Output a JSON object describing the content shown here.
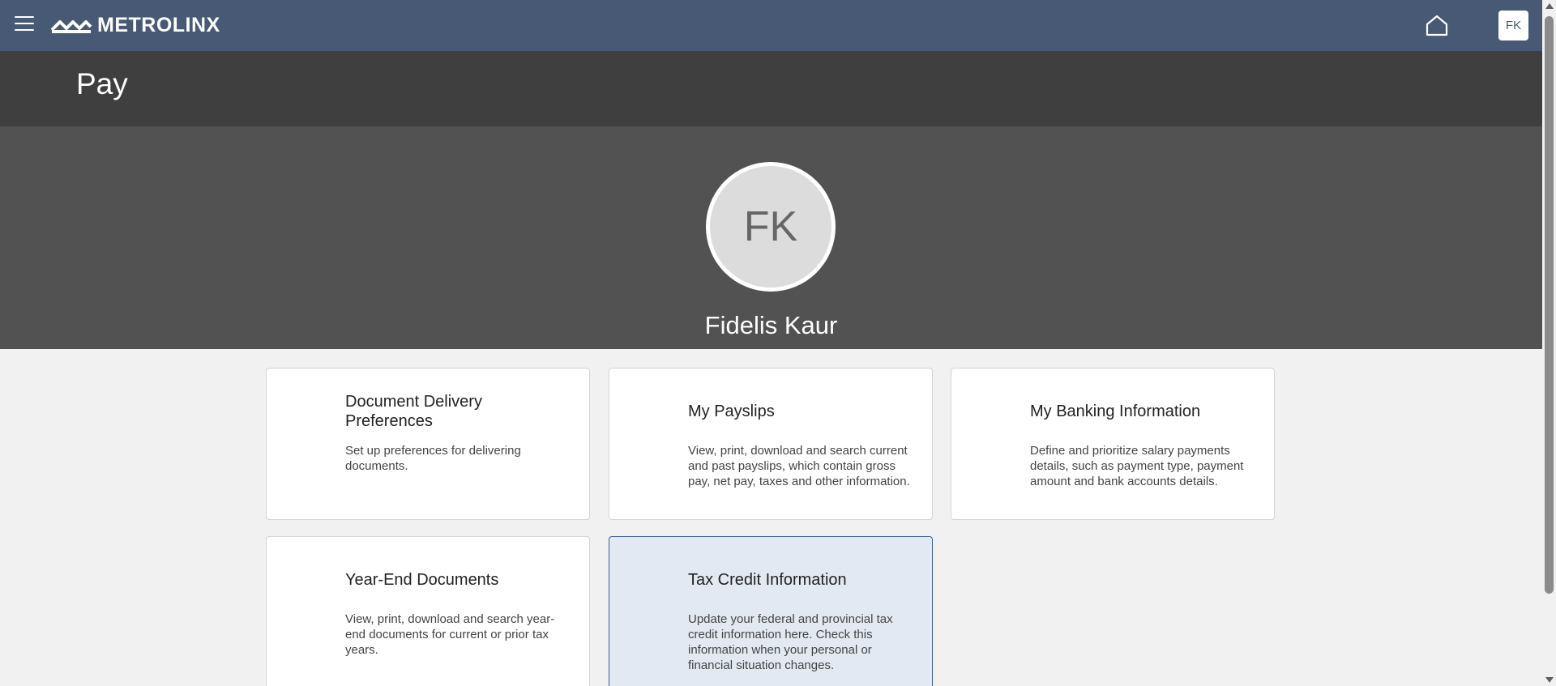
{
  "header": {
    "brand": "METROLINX",
    "user_initials": "FK",
    "icons": {
      "menu": "hamburger-menu-icon",
      "home": "home-icon"
    },
    "colors": {
      "bar": "#475975"
    }
  },
  "page": {
    "title": "Pay"
  },
  "profile": {
    "initials": "FK",
    "name": "Fidelis Kaur"
  },
  "cards": [
    {
      "title": "Document Delivery Preferences",
      "description": "Set up preferences for delivering documents."
    },
    {
      "title": "My Payslips",
      "description": "View, print, download and search current and past payslips, which contain gross pay, net pay, taxes and other information."
    },
    {
      "title": "My Banking Information",
      "description": "Define and prioritize salary payments details, such as payment type, payment amount and bank accounts details."
    },
    {
      "title": "Year-End Documents",
      "description": "View, print, download and search year-end documents for current or prior tax years."
    },
    {
      "title": "Tax Credit Information",
      "description": "Update your federal and provincial tax credit information here. Check this information when your personal or financial situation changes."
    }
  ]
}
